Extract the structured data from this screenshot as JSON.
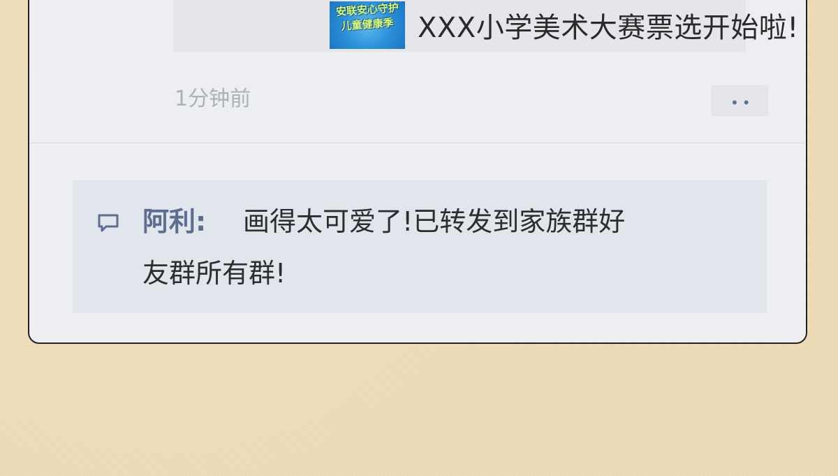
{
  "post": {
    "thumbnail_lines": [
      "安联安心守护",
      "儿童健康季"
    ],
    "share_title": "XXX小学美术大赛票选开始啦!",
    "time": "1分钟前",
    "more_icon": "more-dots-icon"
  },
  "comment": {
    "icon": "comment-bubble-icon",
    "author": "阿利:",
    "text_line1": "画得太可爱了!已转发到家族群好",
    "text_line2": "友群所有群!"
  },
  "colors": {
    "page_background": "#efdbb7",
    "card_background": "#eceef1",
    "accent": "#5c6d8f",
    "muted_text": "#adb0b5"
  }
}
